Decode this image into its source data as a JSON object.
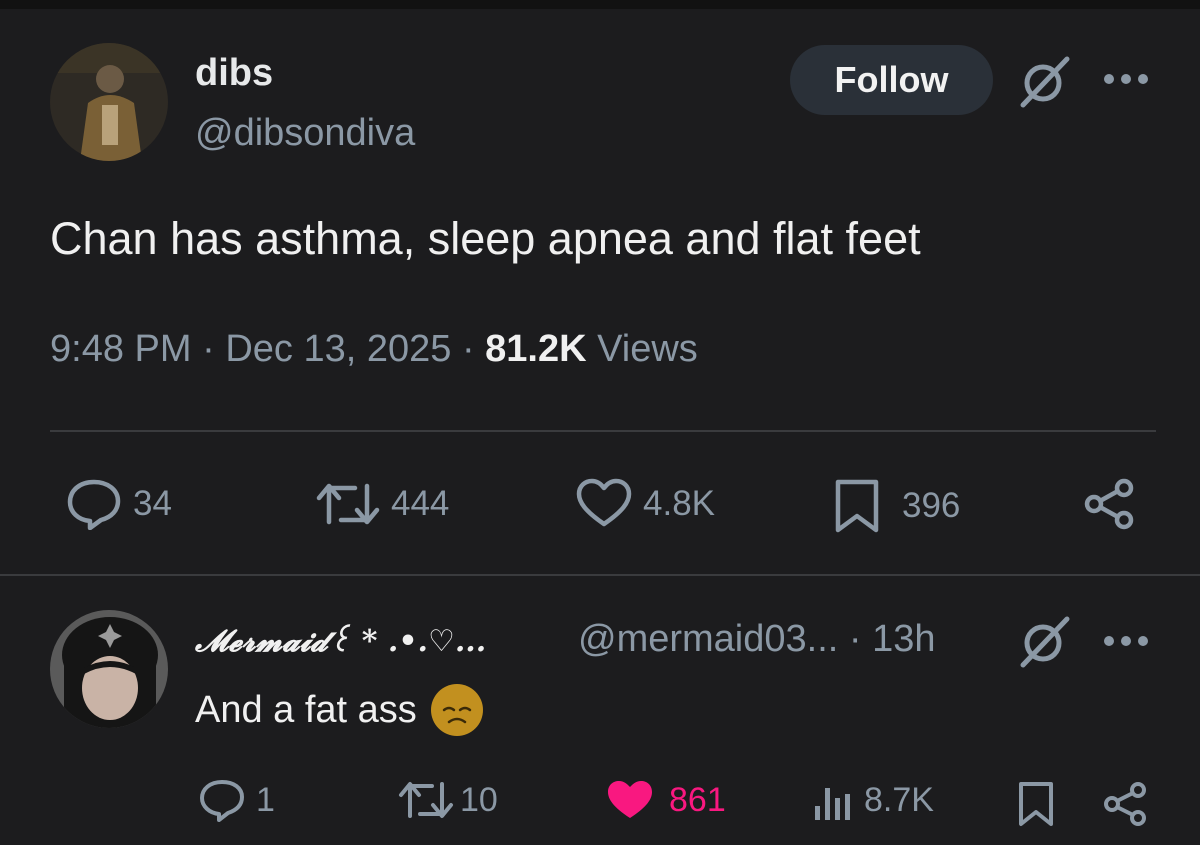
{
  "tweet": {
    "author_name": "dibs",
    "author_handle": "@dibsondiva",
    "follow_label": "Follow",
    "text": "Chan has asthma, sleep apnea and flat feet",
    "time": "9:48 PM",
    "date": "Dec 13, 2025",
    "views_count": "81.2K",
    "views_label": "Views",
    "separator": "·",
    "actions": {
      "replies": "34",
      "reposts": "444",
      "likes": "4.8K",
      "bookmarks": "396"
    }
  },
  "reply": {
    "author_name": "𝓜𝓮𝓻𝓶𝓪𝓲𝓭꒰ * .•.♡...",
    "author_handle": "@mermaid03...",
    "time_ago": "13h",
    "text": "And a fat ass",
    "emoji": "disappointed-face",
    "actions": {
      "replies": "1",
      "reposts": "10",
      "likes": "861",
      "views": "8.7K"
    }
  },
  "colors": {
    "background": "#1c1c1e",
    "text": "#e7e9ea",
    "muted": "#8b98a5",
    "like_active": "#f91880",
    "follow_bg": "#2a3038"
  }
}
